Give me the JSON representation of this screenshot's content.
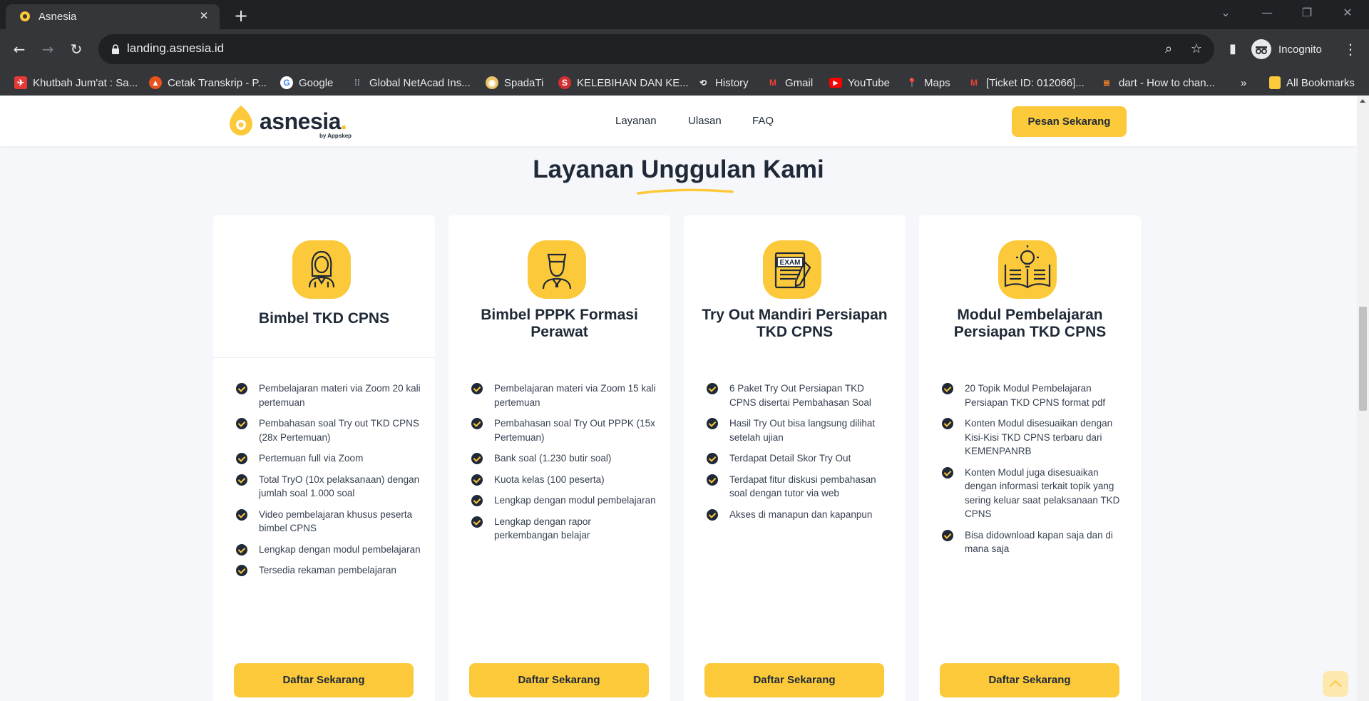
{
  "browser": {
    "tab_title": "Asnesia",
    "url": "landing.asnesia.id",
    "profile_label": "Incognito",
    "bookmarks": [
      {
        "label": "Khutbah Jum'at : Sa...",
        "icon": "khutbah-icon",
        "color": "#e53935"
      },
      {
        "label": "Cetak Transkrip - P...",
        "icon": "cetak-icon",
        "color": "#e8541e"
      },
      {
        "label": "Google",
        "icon": "google-icon",
        "color": "#4285f4"
      },
      {
        "label": "Global NetAcad Ins...",
        "icon": "cisco-icon",
        "color": "#9aa0a6"
      },
      {
        "label": "SpadaTi",
        "icon": "spadati-icon",
        "color": "#e9c46a"
      },
      {
        "label": "KELEBIHAN DAN KE...",
        "icon": "s-icon",
        "color": "#d32f2f"
      },
      {
        "label": "History",
        "icon": "history-icon",
        "color": "#9aa0a6"
      },
      {
        "label": "Gmail",
        "icon": "gmail-icon",
        "color": "#ea4335"
      },
      {
        "label": "YouTube",
        "icon": "youtube-icon",
        "color": "#ff0000"
      },
      {
        "label": "Maps",
        "icon": "maps-icon",
        "color": "#34a853"
      },
      {
        "label": "[Ticket ID: 012066]...",
        "icon": "gmail-icon",
        "color": "#ea4335"
      },
      {
        "label": "dart - How to chan...",
        "icon": "stackoverflow-icon",
        "color": "#f48024"
      }
    ],
    "all_bookmarks_label": "All Bookmarks",
    "overflow_label": "»"
  },
  "site": {
    "logo_text": "asnesia",
    "logo_dot": ".",
    "logo_by": "by Appskep",
    "nav": [
      "Layanan",
      "Ulasan",
      "FAQ"
    ],
    "cta_label": "Pesan Sekarang",
    "accent_color": "#fcc93a"
  },
  "section": {
    "title_part1": "Layanan",
    "title_part2": "Unggulan",
    "title_part3": "Kami"
  },
  "cards": [
    {
      "title": "Bimbel TKD CPNS",
      "icon": "female-student-icon",
      "features": [
        "Pembelajaran materi via Zoom 20 kali pertemuan",
        "Pembahasan soal Try out TKD CPNS (28x Pertemuan)",
        "Pertemuan full via Zoom",
        "Total TryO (10x pelaksanaan) dengan jumlah soal 1.000 soal",
        "Video pembelajaran khusus peserta bimbel CPNS",
        "Lengkap dengan modul pembelajaran",
        "Tersedia rekaman pembelajaran"
      ],
      "button": "Daftar Sekarang"
    },
    {
      "title": "Bimbel PPPK Formasi Perawat",
      "icon": "nurse-icon",
      "features": [
        "Pembelajaran materi via Zoom 15 kali pertemuan",
        "Pembahasan soal Try Out PPPK (15x Pertemuan)",
        "Bank soal (1.230 butir soal)",
        "Kuota kelas (100 peserta)",
        "Lengkap dengan modul pembelajaran",
        "Lengkap dengan rapor perkembangan belajar"
      ],
      "button": "Daftar Sekarang"
    },
    {
      "title": "Try Out Mandiri Persiapan TKD CPNS",
      "icon": "exam-icon",
      "icon_text": "EXAM",
      "features": [
        "6 Paket Try Out Persiapan TKD CPNS disertai Pembahasan Soal",
        "Hasil Try Out bisa langsung dilihat setelah ujian",
        "Terdapat Detail Skor Try Out",
        "Terdapat fitur diskusi pembahasan soal dengan tutor via web",
        "Akses di manapun dan kapanpun"
      ],
      "button": "Daftar Sekarang"
    },
    {
      "title": "Modul Pembelajaran Persiapan TKD CPNS",
      "icon": "book-bulb-icon",
      "features": [
        "20 Topik Modul Pembelajaran Persiapan TKD CPNS format pdf",
        "Konten Modul disesuaikan dengan Kisi-Kisi TKD CPNS terbaru dari KEMENPANRB",
        "Konten Modul juga disesuaikan dengan informasi terkait topik yang sering keluar saat pelaksanaan TKD CPNS",
        "Bisa didownload kapan saja dan di mana saja"
      ],
      "button": "Daftar Sekarang"
    }
  ]
}
